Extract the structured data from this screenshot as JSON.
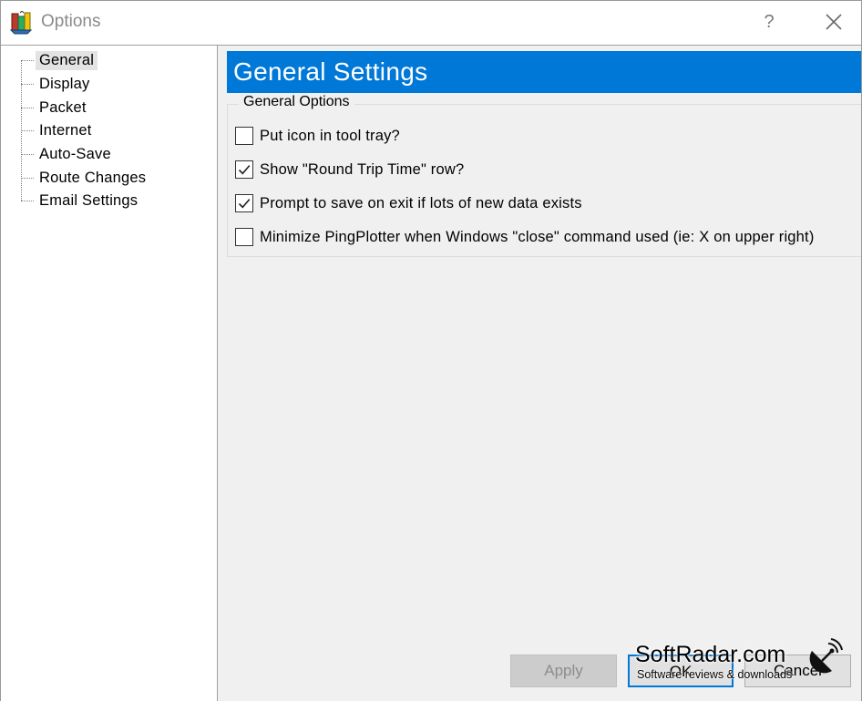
{
  "window": {
    "title": "Options",
    "help_glyph": "?"
  },
  "tree": {
    "items": [
      {
        "label": "General",
        "selected": true
      },
      {
        "label": "Display"
      },
      {
        "label": "Packet"
      },
      {
        "label": "Internet"
      },
      {
        "label": "Auto-Save"
      },
      {
        "label": "Route Changes"
      },
      {
        "label": "Email Settings"
      }
    ]
  },
  "panel": {
    "title": "General Settings",
    "group_title": "General Options",
    "options": [
      {
        "label": "Put icon in tool tray?",
        "checked": false
      },
      {
        "label": "Show \"Round Trip Time\" row?",
        "checked": true
      },
      {
        "label": "Prompt to save on exit if lots of new data exists",
        "checked": true
      },
      {
        "label": "Minimize PingPlotter when Windows \"close\" command used (ie: X on upper right)",
        "checked": false
      }
    ]
  },
  "buttons": {
    "apply": "Apply",
    "ok": "OK",
    "cancel": "Cancel"
  },
  "watermark": {
    "brand": "SoftRadar.com",
    "tagline": "Software reviews & downloads"
  },
  "colors": {
    "accent": "#0078d7",
    "panel_bg": "#f0f0f0"
  },
  "icons": {
    "app": "pingplotter-app-icon",
    "help": "help-icon",
    "close": "close-icon",
    "check": "check-icon",
    "watermark": "radar-dish-icon"
  }
}
